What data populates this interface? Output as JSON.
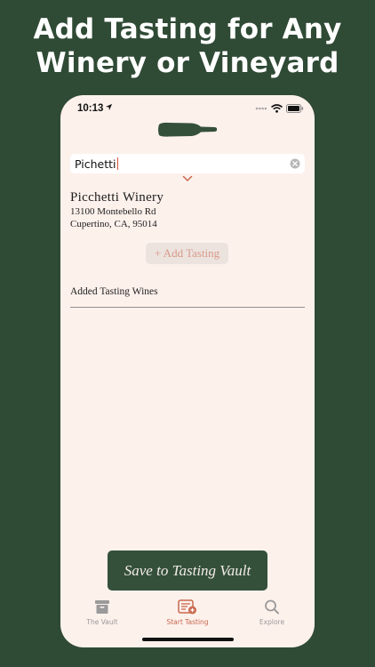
{
  "headline": {
    "line1": "Add Tasting for Any",
    "line2": "Winery or Vineyard"
  },
  "status_bar": {
    "time": "10:13",
    "icons": [
      "location-arrow-icon",
      "signal-dots-icon",
      "wifi-icon",
      "battery-icon"
    ]
  },
  "logo": {
    "icon": "wine-bottle-icon"
  },
  "search": {
    "value": "Pichetti",
    "clear_icon": "clear-circle-icon"
  },
  "result_toggle": {
    "icon": "chevron-down-icon"
  },
  "winery": {
    "name": "Picchetti Winery",
    "address_line1": "13100 Montebello Rd",
    "address_line2": "Cupertino, CA, 95014"
  },
  "add_tasting_button": {
    "label": "+ Add Tasting"
  },
  "added_section": {
    "title": "Added Tasting Wines"
  },
  "save_button": {
    "label": "Save to Tasting Vault"
  },
  "tabs": [
    {
      "label": "The Vault",
      "icon": "archive-box-icon",
      "active": false
    },
    {
      "label": "Start Tasting",
      "icon": "tasting-form-add-icon",
      "active": true
    },
    {
      "label": "Explore",
      "icon": "search-icon",
      "active": false
    }
  ],
  "colors": {
    "background": "#2f4a35",
    "screen": "#fdf1ec",
    "accent": "#c9684e",
    "save_button": "#34503b"
  }
}
